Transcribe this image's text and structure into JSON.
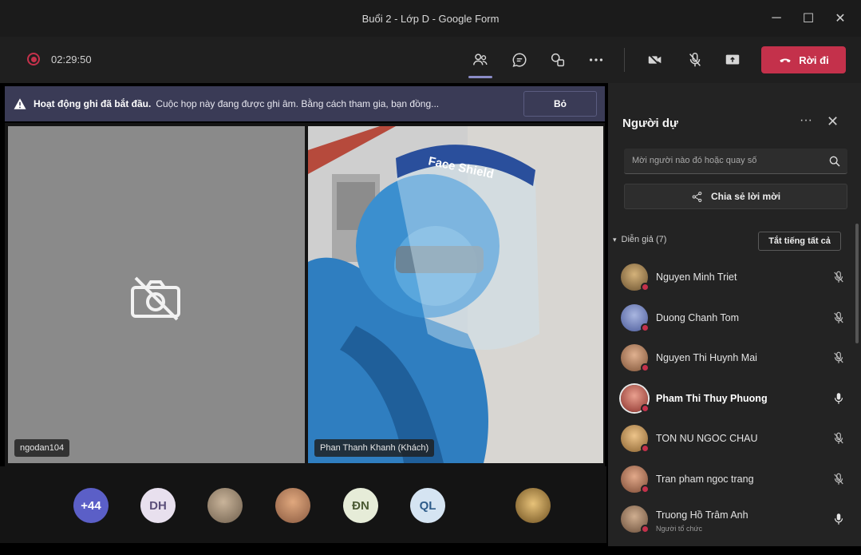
{
  "window": {
    "title": "Buổi 2 - Lớp D - Google Form",
    "controls": [
      "─",
      "☐",
      "✕"
    ]
  },
  "toolbar": {
    "recording_time": "02:29:50",
    "leave_label": "Rời đi",
    "leave_color": "#c4314b",
    "icons": [
      "participants-icon",
      "chat-icon",
      "reactions-icon",
      "more-icon",
      "camera-off-icon",
      "mic-off-icon",
      "share-screen-icon"
    ]
  },
  "banner": {
    "title": "Hoạt động ghi đã bắt đầu.",
    "message": "Cuộc họp này đang được ghi âm. Bằng cách tham gia, bạn đồng...",
    "button": "Bỏ"
  },
  "stage": {
    "left_tile_name": "ngodan104",
    "right_tile_name": "Phan Thanh Khanh (Khách)",
    "shield_text": "Face Shield"
  },
  "strip": {
    "overflow": "+44",
    "avatars": [
      {
        "initials": "DH",
        "bg": "#e8e0ee",
        "fg": "#5b4f7a"
      },
      {
        "initials": "",
        "bg": "#8b7d6b",
        "fg": "#fff"
      },
      {
        "initials": "",
        "bg": "#b8826a",
        "fg": "#fff"
      },
      {
        "initials": "ĐN",
        "bg": "#e6ecd8",
        "fg": "#4b5a34"
      },
      {
        "initials": "QL",
        "bg": "#d5e4f2",
        "fg": "#2f5c8a"
      },
      {
        "initials": "",
        "bg": "#9c7a3c",
        "fg": "#fff"
      }
    ]
  },
  "panel": {
    "title": "Người dự",
    "more": "···",
    "close": "✕",
    "search_placeholder": "Mời người nào đó hoặc quay số",
    "share_label": "Chia sẻ lời mời",
    "section_label": "Diễn giả (7)",
    "mute_all": "Tắt tiếng tất cả",
    "participants": [
      {
        "name": "Nguyen Minh Triet",
        "bold": false,
        "mic": "off",
        "color": "#a8895a"
      },
      {
        "name": "Duong Chanh Tom",
        "bold": false,
        "mic": "off",
        "color": "#7c88b6"
      },
      {
        "name": "Nguyen Thi Huynh Mai",
        "bold": false,
        "mic": "off",
        "color": "#b4846a"
      },
      {
        "name": "Pham Thi Thuy Phuong",
        "bold": true,
        "mic": "on",
        "color": "#b0504a"
      },
      {
        "name": "TON NU NGOC CHAU",
        "bold": false,
        "mic": "off",
        "color": "#c69a62"
      },
      {
        "name": "Tran pham ngoc trang",
        "bold": false,
        "mic": "off",
        "color": "#b07a5e"
      },
      {
        "name": "Truong Hồ Trâm Anh",
        "sub": "Người tổ chức",
        "bold": false,
        "mic": "on",
        "color": "#9a7c66"
      }
    ]
  }
}
